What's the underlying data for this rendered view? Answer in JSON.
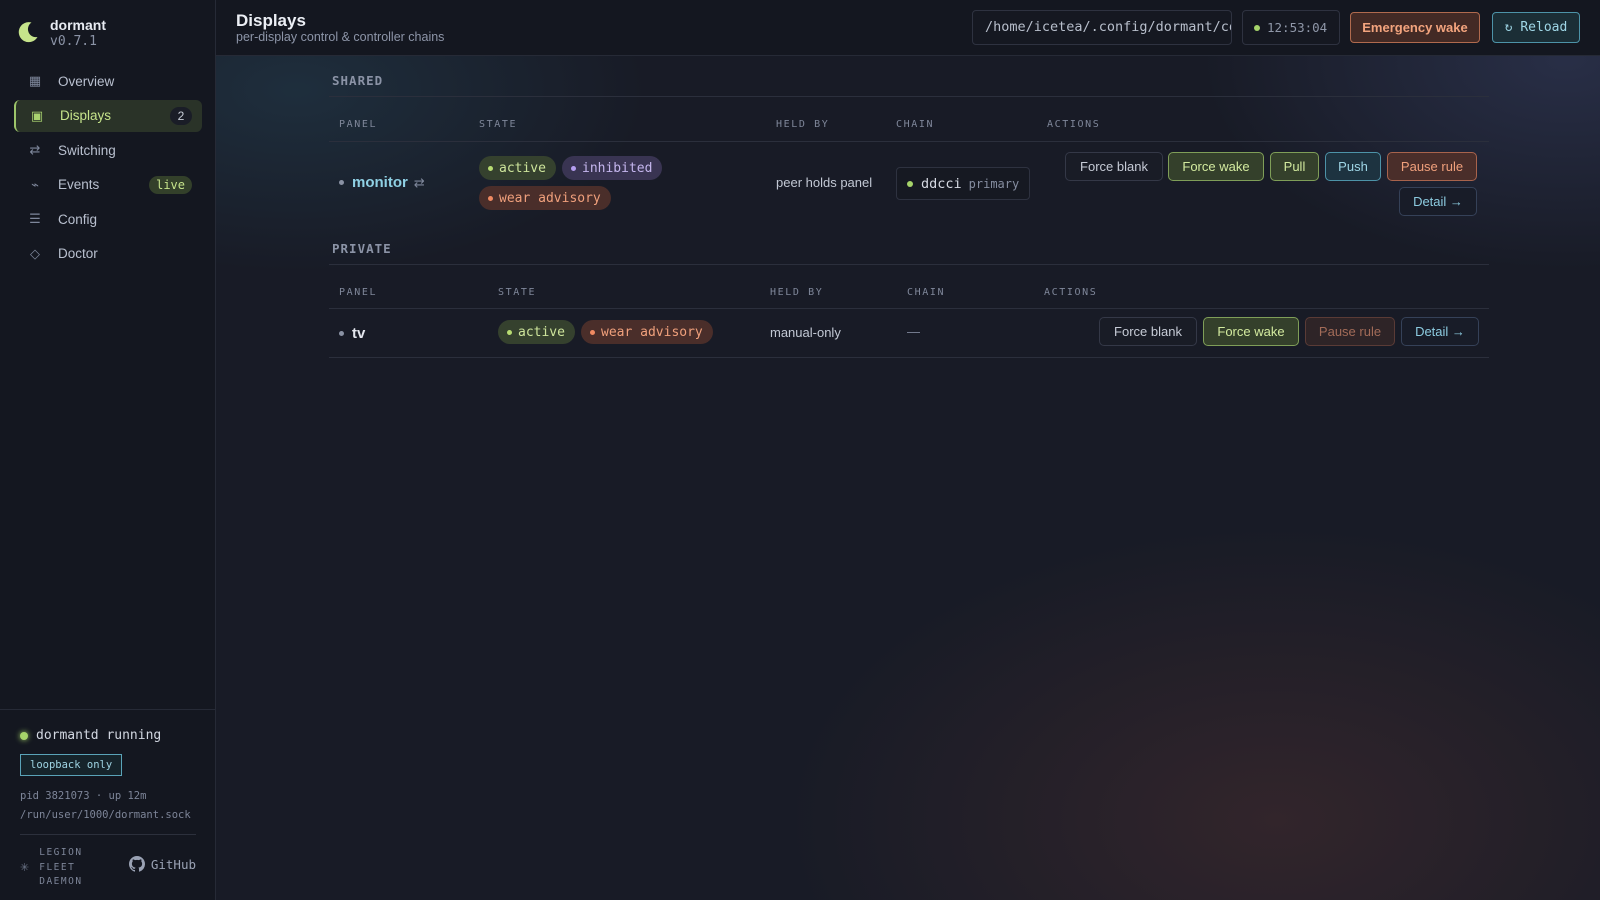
{
  "brand": {
    "name": "dormant",
    "version": "v0.7.1"
  },
  "nav": [
    {
      "label": "Overview",
      "icon": "grid-icon"
    },
    {
      "label": "Displays",
      "icon": "display-icon",
      "badge": "2",
      "active": true
    },
    {
      "label": "Switching",
      "icon": "swap-icon"
    },
    {
      "label": "Events",
      "icon": "pulse-icon",
      "live": "live"
    },
    {
      "label": "Config",
      "icon": "lines-icon"
    },
    {
      "label": "Doctor",
      "icon": "diamond-icon"
    }
  ],
  "footer": {
    "daemon_status": "dormantd running",
    "loopback": "loopback only",
    "pid_uptime": "pid 3821073 · up 12m",
    "socket": "/run/user/1000/dormant.sock",
    "legion": [
      "LEGION",
      "FLEET",
      "DAEMON"
    ],
    "github": "GitHub"
  },
  "header": {
    "title": "Displays",
    "subtitle": "per-display control & controller chains",
    "config_path": "/home/icetea/.config/dormant/config.toml",
    "clock": "12:53:04",
    "emergency_label": "Emergency wake",
    "reload_label": "↻ Reload"
  },
  "columns": {
    "panel": "PANEL",
    "state": "STATE",
    "held_by": "HELD BY",
    "chain": "CHAIN",
    "actions": "ACTIONS"
  },
  "shared": {
    "label": "SHARED",
    "row": {
      "panel": "monitor",
      "states": [
        "active",
        "inhibited",
        "wear advisory"
      ],
      "held_by": "peer holds panel",
      "chain_name": "ddcci",
      "chain_role": "primary",
      "actions": [
        "Force blank",
        "Force wake",
        "Pull",
        "Push",
        "Pause rule",
        "Detail →"
      ]
    }
  },
  "private": {
    "label": "PRIVATE",
    "row": {
      "panel": "tv",
      "states": [
        "active",
        "wear advisory"
      ],
      "held_by": "manual-only",
      "chain": "—",
      "actions": [
        "Force blank",
        "Force wake",
        "Pause rule",
        "Detail →"
      ]
    }
  },
  "colors": {
    "accent_green": "#a6d46a",
    "accent_cyan": "#8fd0e4",
    "accent_orange": "#f0a07c",
    "accent_purple": "#b59ef0"
  }
}
